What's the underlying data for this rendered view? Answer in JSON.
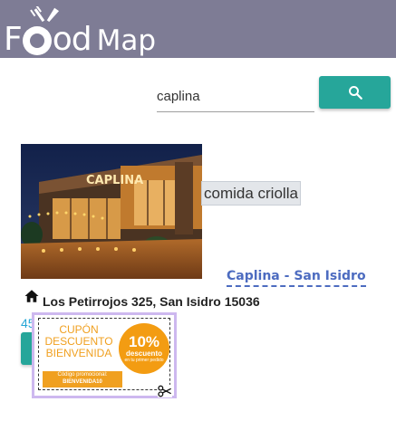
{
  "app": {
    "logo_prefix": "F",
    "logo_suffix": "od",
    "logo_map": "Map",
    "header_color": "#7e7c95"
  },
  "search": {
    "value": "caplina",
    "button_icon": "search-icon",
    "button_color": "#26a69a"
  },
  "restaurant": {
    "category": "comida criolla",
    "name_link": "Caplina - San Isidro",
    "address": "Los Petirrojos 325, San Isidro 15036",
    "address_icon": "home-icon",
    "partial_number": "45",
    "photo_sign_text": "CAPLINA"
  },
  "coupon": {
    "title": "CUPÓN\nDESCUENTO\nBIENVENIDA",
    "percent": "10%",
    "badge_word": "descuento",
    "badge_small": "en tu primer pedido",
    "code_label": "Código promocional:",
    "code": "BIENVENIDA10",
    "accent_color": "#f0a020",
    "frame_color": "#cdb8ef",
    "cut_icon": "scissors-icon"
  }
}
